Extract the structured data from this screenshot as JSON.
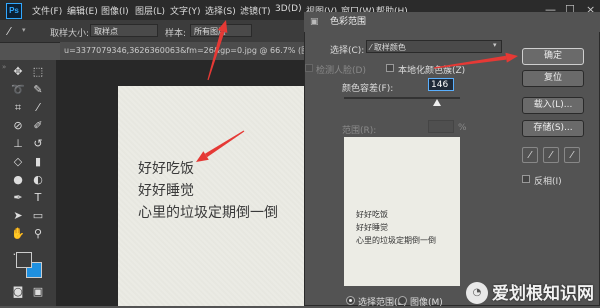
{
  "app": {
    "logo": "Ps"
  },
  "menubar": {
    "items": [
      "文件(F)",
      "编辑(E)",
      "图像(I)",
      "图层(L)",
      "文字(Y)",
      "选择(S)",
      "滤镜(T)",
      "3D(D)",
      "视图(V)",
      "窗口(W)",
      "帮助(H)"
    ],
    "window_controls": {
      "minimize": "—",
      "maximize": "☐",
      "close": "×"
    }
  },
  "options_bar": {
    "sample_size_label": "取样大小:",
    "sample_size_value": "取样点",
    "sample_label": "样本:",
    "sample_value": "所有图层"
  },
  "document_tab": {
    "title": "u=3377079346,3626360063&fm=26&gp=0.jpg @ 66.7% (图层 1, RGB"
  },
  "canvas": {
    "lines": [
      "好好吃饭",
      "好好睡觉",
      "心里的垃圾定期倒一倒"
    ]
  },
  "dialog": {
    "title": "色彩范围",
    "select_label": "选择(C):",
    "select_value": "取样颜色",
    "detect_faces_label": "检测人脸(D)",
    "localized_label": "本地化颜色簇(Z)",
    "fuzziness_label": "颜色容差(F):",
    "fuzziness_value": "146",
    "range_label": "范围(R):",
    "range_unit": "%",
    "preview_lines": [
      "好好吃饭",
      "好好睡觉",
      "心里的垃圾定期倒一倒"
    ],
    "buttons": {
      "ok": "确定",
      "reset": "复位",
      "load": "载入(L)...",
      "save": "存储(S)..."
    },
    "invert_label": "反相(I)",
    "radio_selection": "选择范围(E)",
    "radio_image": "图像(M)"
  },
  "watermark": {
    "text": "爱划根知识网"
  },
  "colors": {
    "accent": "#e53935",
    "swatch_fg": "#3d3d3d",
    "swatch_bg": "#1e90e0"
  }
}
